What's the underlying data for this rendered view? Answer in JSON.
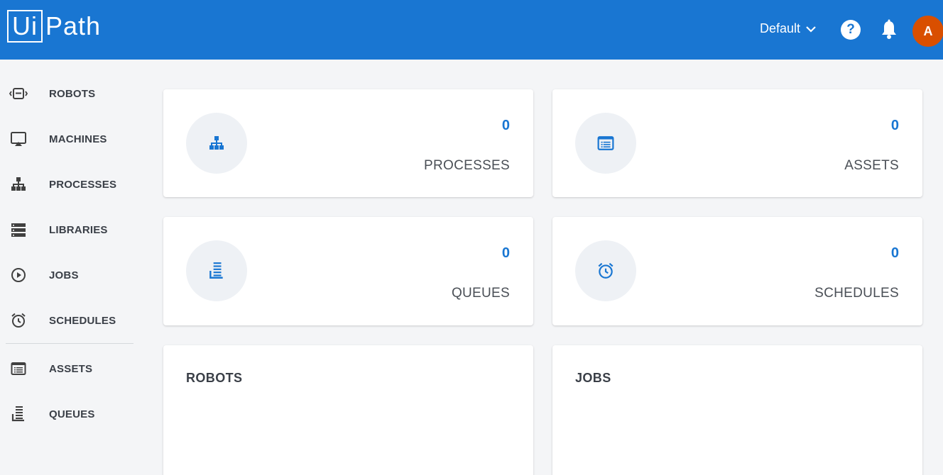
{
  "header": {
    "logo_ui": "Ui",
    "logo_path": "Path",
    "tenant": "Default",
    "help_label": "?",
    "avatar_initial": "A",
    "colors": {
      "bar": "#1976d2",
      "avatar": "#d94f00"
    }
  },
  "sidebar": {
    "items": [
      {
        "label": "ROBOTS",
        "icon": "robot-icon"
      },
      {
        "label": "MACHINES",
        "icon": "monitor-icon"
      },
      {
        "label": "PROCESSES",
        "icon": "sitemap-icon"
      },
      {
        "label": "LIBRARIES",
        "icon": "library-icon"
      },
      {
        "label": "JOBS",
        "icon": "play-circle-icon"
      },
      {
        "label": "SCHEDULES",
        "icon": "alarm-clock-icon"
      },
      {
        "label": "ASSETS",
        "icon": "list-box-icon"
      },
      {
        "label": "QUEUES",
        "icon": "queue-icon"
      }
    ]
  },
  "dashboard": {
    "stats": [
      {
        "count": "0",
        "label": "PROCESSES",
        "icon": "sitemap-icon"
      },
      {
        "count": "0",
        "label": "ASSETS",
        "icon": "list-box-icon"
      },
      {
        "count": "0",
        "label": "QUEUES",
        "icon": "queue-icon"
      },
      {
        "count": "0",
        "label": "SCHEDULES",
        "icon": "alarm-clock-icon"
      }
    ],
    "panels": [
      {
        "title": "ROBOTS"
      },
      {
        "title": "JOBS"
      }
    ]
  }
}
